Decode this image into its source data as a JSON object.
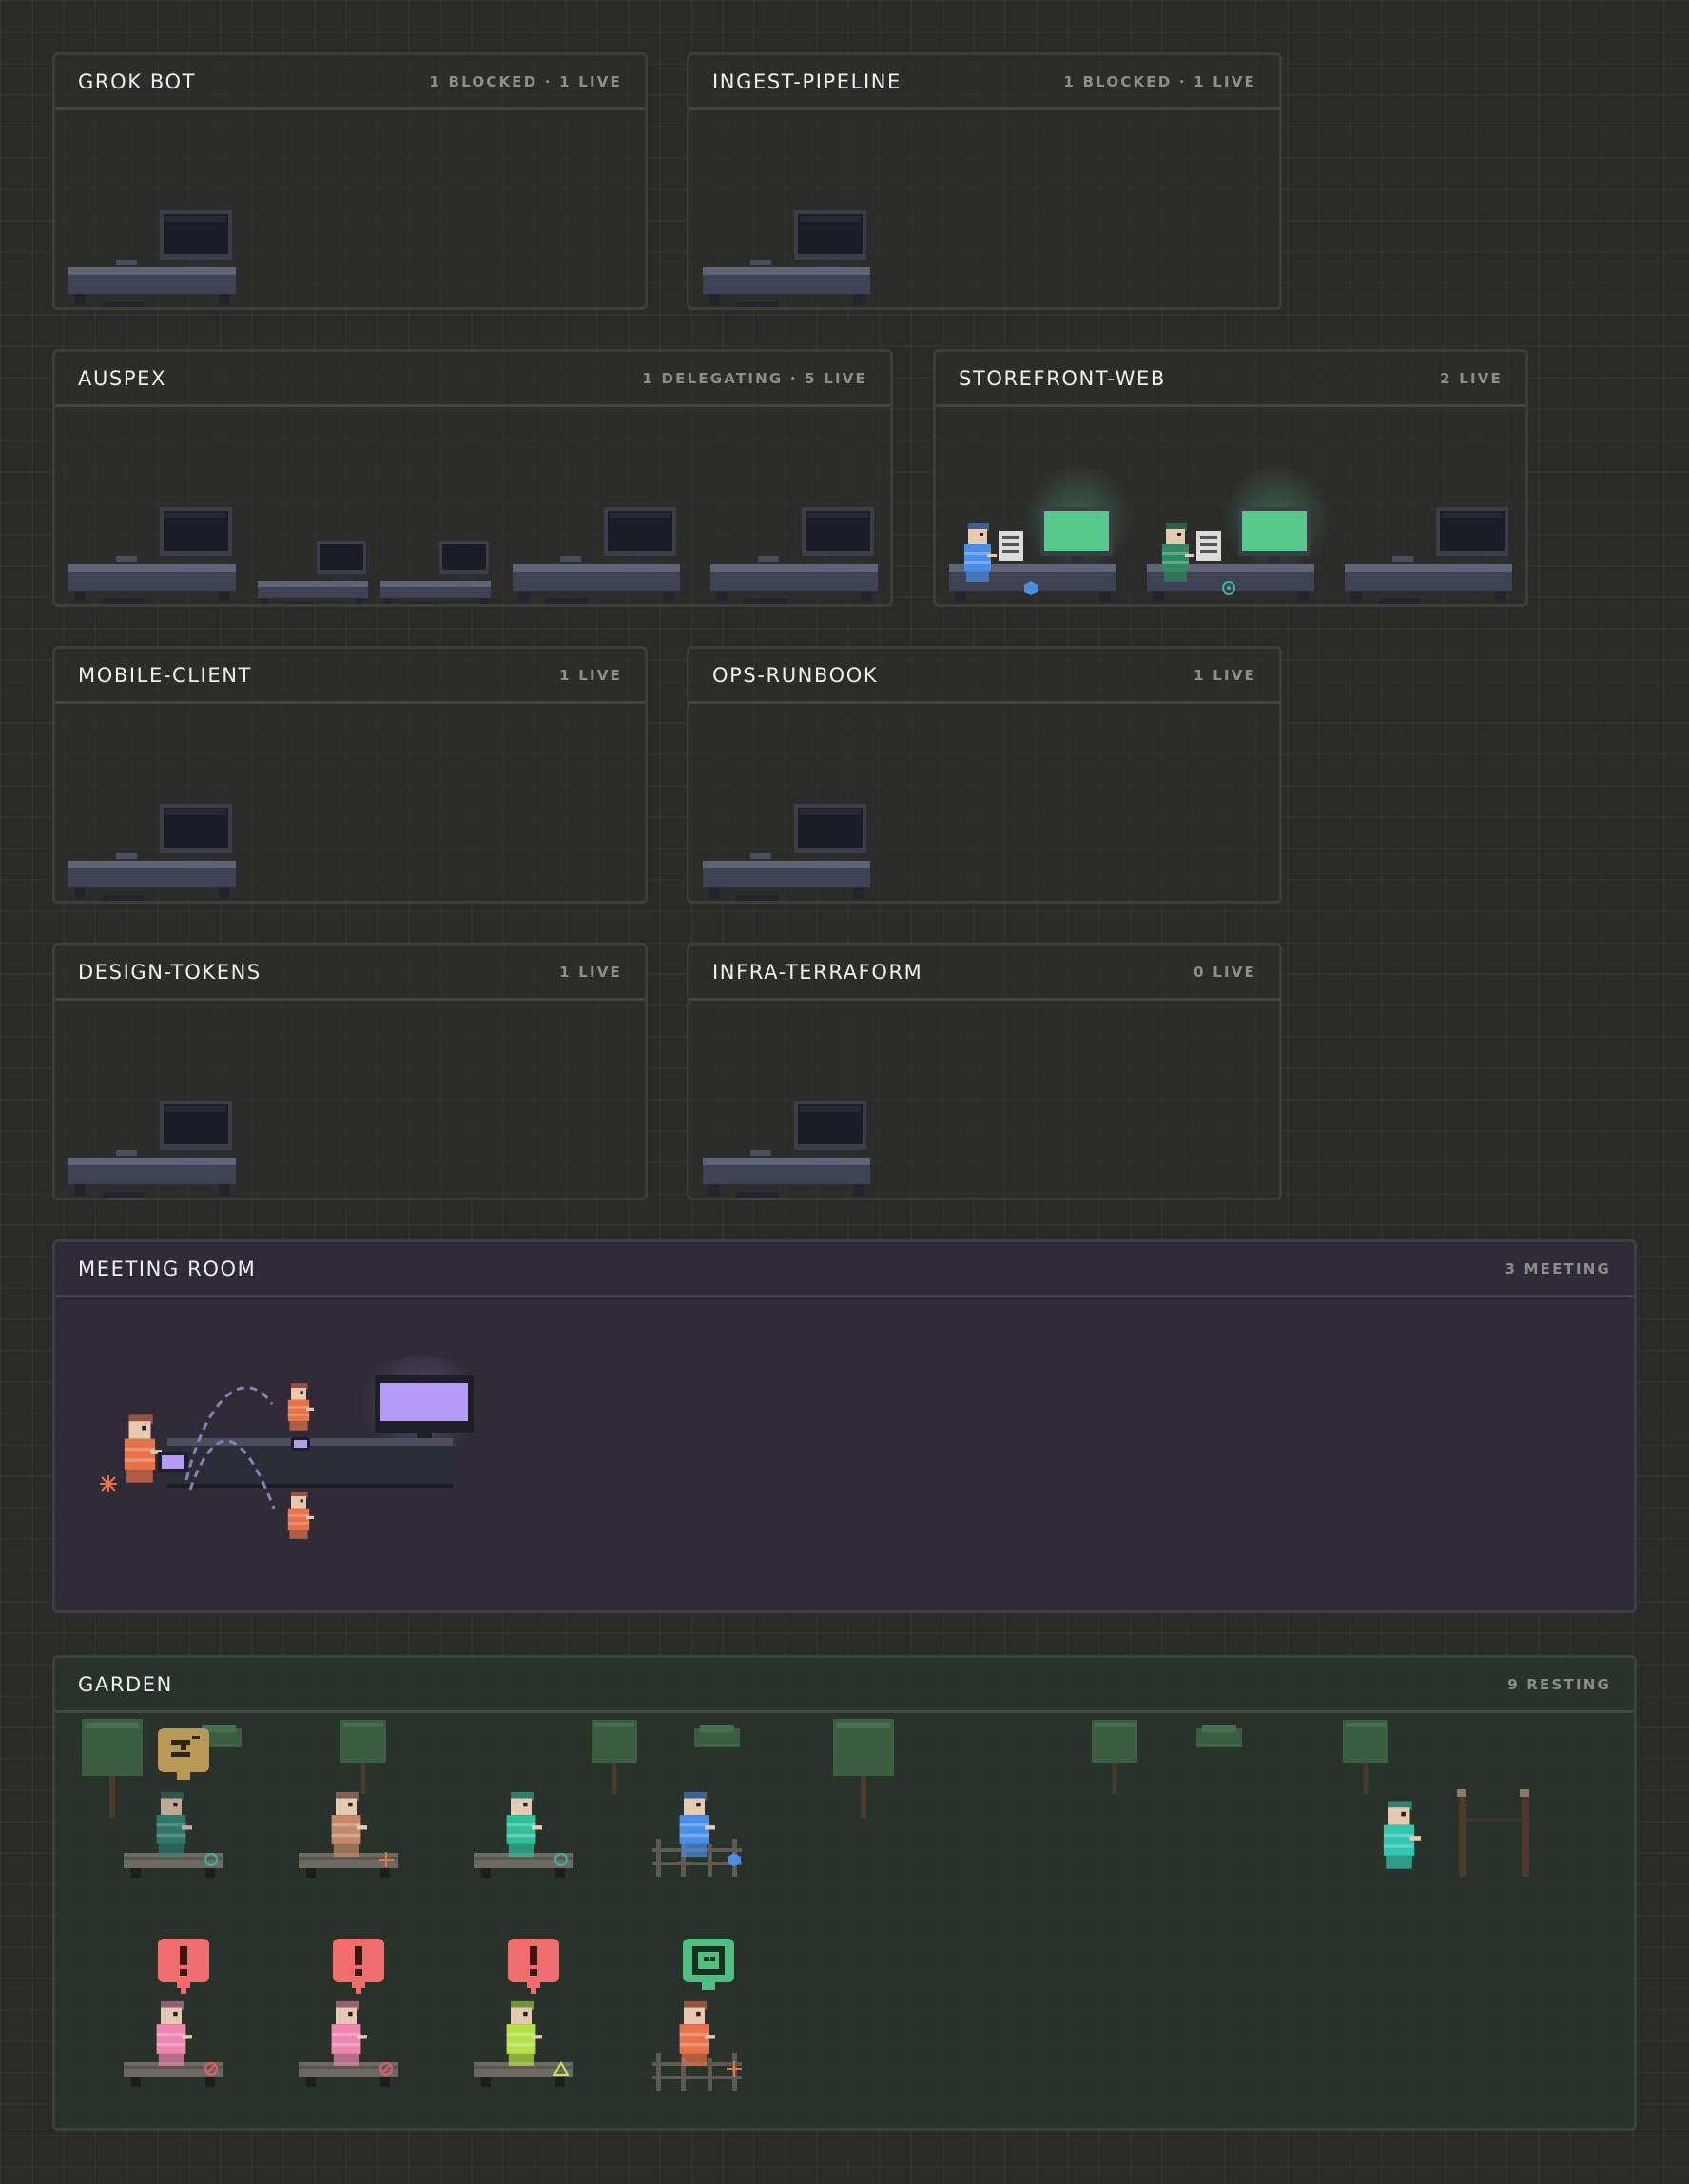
{
  "rooms": {
    "grok_bot": {
      "title": "GROK BOT",
      "status": "1 BLOCKED · 1 LIVE"
    },
    "ingest_pipeline": {
      "title": "INGEST-PIPELINE",
      "status": "1 BLOCKED · 1 LIVE"
    },
    "auspex": {
      "title": "AUSPEX",
      "status": "1 DELEGATING · 5 LIVE"
    },
    "storefront_web": {
      "title": "STOREFRONT-WEB",
      "status": "2 LIVE"
    },
    "mobile_client": {
      "title": "MOBILE-CLIENT",
      "status": "1 LIVE"
    },
    "ops_runbook": {
      "title": "OPS-RUNBOOK",
      "status": "1 LIVE"
    },
    "design_tokens": {
      "title": "DESIGN-TOKENS",
      "status": "1 LIVE"
    },
    "infra_terraform": {
      "title": "INFRA-TERRAFORM",
      "status": "0 LIVE"
    },
    "meeting_room": {
      "title": "MEETING ROOM",
      "status": "3 MEETING"
    },
    "garden": {
      "title": "GARDEN",
      "status": "9 RESTING"
    }
  },
  "colors": {
    "desk": "#555a6e",
    "monitor_off": "#1e1f26",
    "monitor_on": "#56c98a",
    "meeting_screen": "#b49cf5",
    "alert_bubble": "#f26d6d",
    "ok_bubble": "#4fbf7f",
    "sleep_bubble": "#b89a56"
  }
}
